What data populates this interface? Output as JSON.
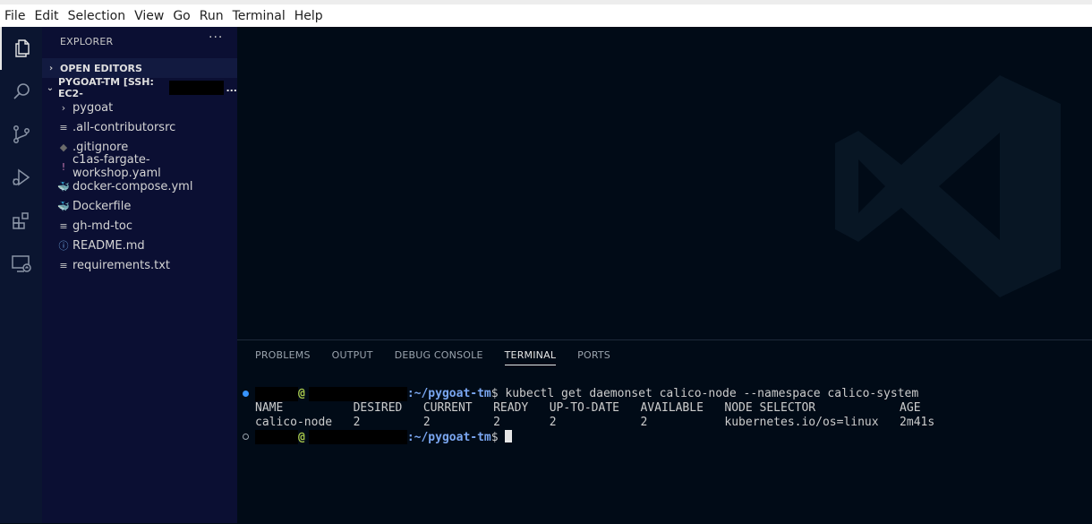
{
  "menu": [
    "File",
    "Edit",
    "Selection",
    "View",
    "Go",
    "Run",
    "Terminal",
    "Help"
  ],
  "activity_bar": [
    "files-icon",
    "search-icon",
    "source-control-icon",
    "run-debug-icon",
    "extensions-icon",
    "remote-explorer-icon"
  ],
  "sidebar": {
    "title": "EXPLORER",
    "more": "···",
    "open_editors": "OPEN EDITORS",
    "workspace": "PYGOAT-TM [SSH: EC2-",
    "workspace_more": "...",
    "items": [
      {
        "icon": "›",
        "label": "pygoat",
        "icon_name": "chevron-right-icon",
        "color": "#c8c8c8"
      },
      {
        "icon": "≡",
        "label": ".all-contributorsrc",
        "icon_name": "file-lines-icon",
        "color": "#c8c8c8"
      },
      {
        "icon": "◆",
        "label": ".gitignore",
        "icon_name": "git-icon",
        "color": "#6b6b6b"
      },
      {
        "icon": "!",
        "label": "c1as-fargate-workshop.yaml",
        "icon_name": "yaml-icon",
        "color": "#c87ab0"
      },
      {
        "icon": "🐳",
        "label": "docker-compose.yml",
        "icon_name": "docker-compose-icon",
        "color": "#e0606d"
      },
      {
        "icon": "🐳",
        "label": "Dockerfile",
        "icon_name": "docker-icon",
        "color": "#4a9be0"
      },
      {
        "icon": "≡",
        "label": "gh-md-toc",
        "icon_name": "file-lines-icon",
        "color": "#c8c8c8"
      },
      {
        "icon": "ⓘ",
        "label": "README.md",
        "icon_name": "info-icon",
        "color": "#6ea6e0"
      },
      {
        "icon": "≡",
        "label": "requirements.txt",
        "icon_name": "file-lines-icon",
        "color": "#c8c8c8"
      }
    ]
  },
  "panel": {
    "tabs": [
      "PROBLEMS",
      "OUTPUT",
      "DEBUG CONSOLE",
      "TERMINAL",
      "PORTS"
    ],
    "active_tab": "TERMINAL"
  },
  "terminal": {
    "at": "@",
    "path": ":~/pygoat-tm",
    "prompt": "$",
    "command": " kubectl get daemonset calico-node --namespace calico-system",
    "header": "NAME          DESIRED   CURRENT   READY   UP-TO-DATE   AVAILABLE   NODE SELECTOR            AGE",
    "row": "calico-node   2         2         2       2            2           kubernetes.io/os=linux   2m41s"
  },
  "colors": {
    "accent": "#3794ff",
    "prompt_user": "#a6c64a",
    "prompt_path": "#7aa6f0"
  }
}
